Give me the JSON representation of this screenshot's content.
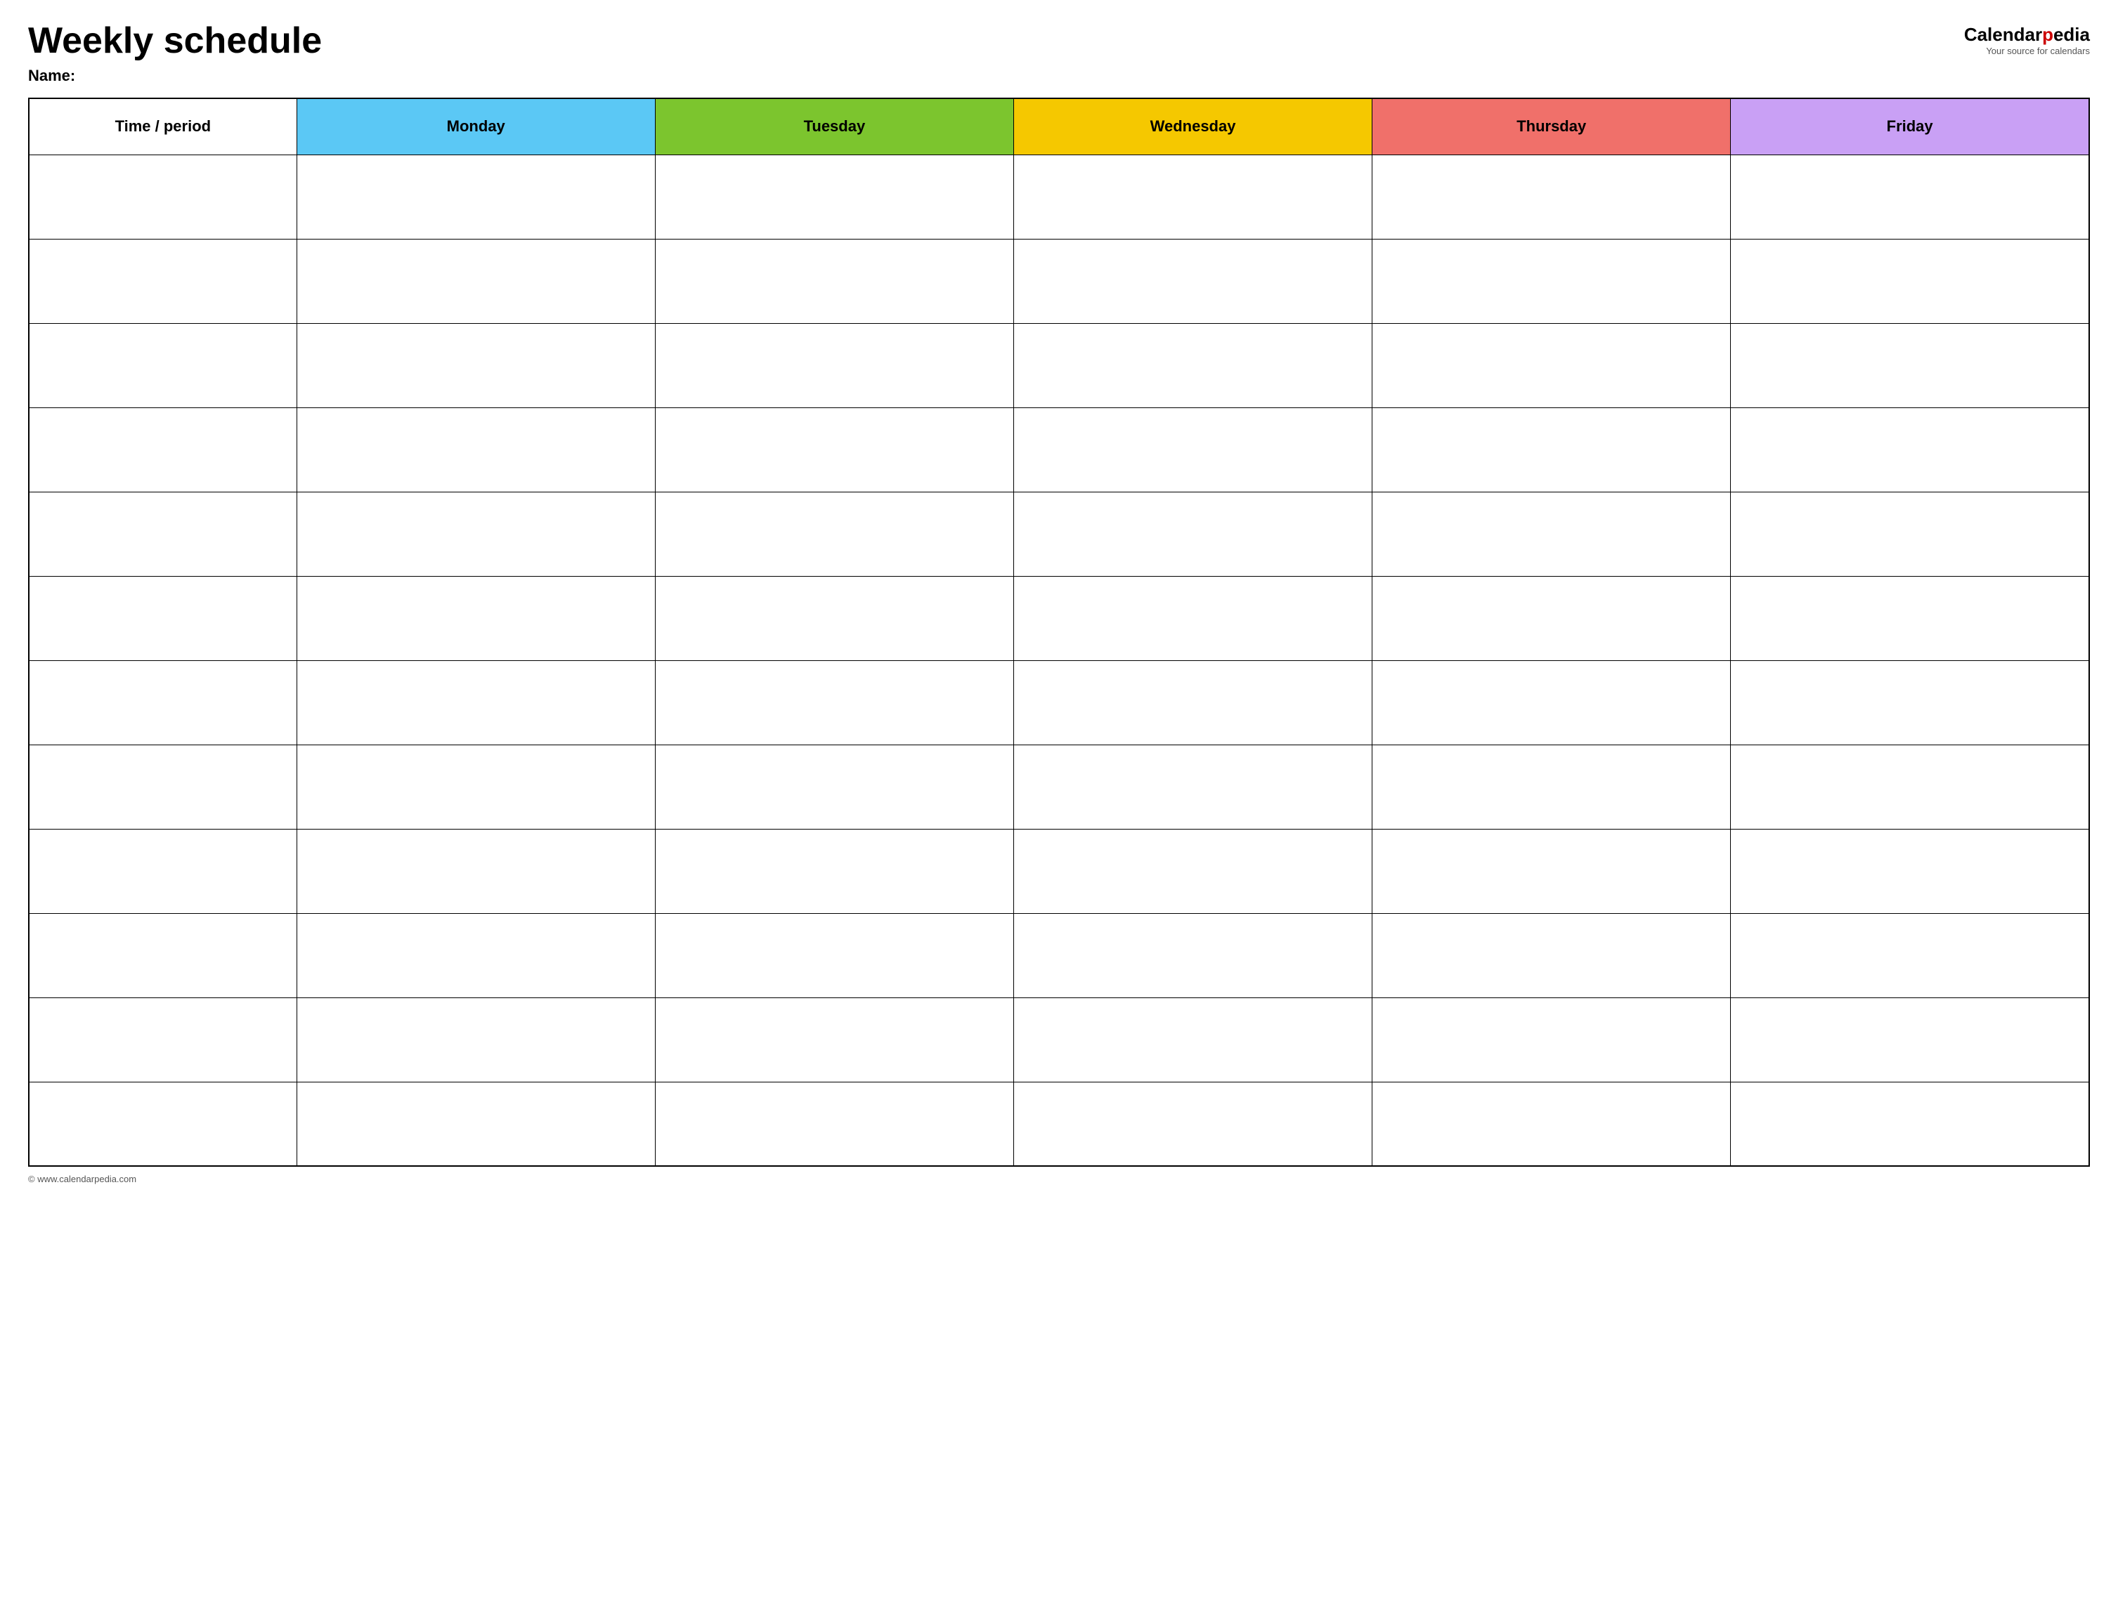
{
  "header": {
    "title": "Weekly schedule",
    "name_label": "Name:",
    "logo_calendar": "Calendar",
    "logo_pedia": "pedia",
    "logo_tagline": "Your source for calendars",
    "logo_url": "www.calendarpedia.com"
  },
  "table": {
    "columns": [
      {
        "id": "time",
        "label": "Time / period",
        "color": "#ffffff"
      },
      {
        "id": "monday",
        "label": "Monday",
        "color": "#5bc8f5"
      },
      {
        "id": "tuesday",
        "label": "Tuesday",
        "color": "#7cc52e"
      },
      {
        "id": "wednesday",
        "label": "Wednesday",
        "color": "#f5c800"
      },
      {
        "id": "thursday",
        "label": "Thursday",
        "color": "#f0706a"
      },
      {
        "id": "friday",
        "label": "Friday",
        "color": "#c9a0f5"
      }
    ],
    "row_count": 12
  },
  "footer": {
    "copyright": "© www.calendarpedia.com"
  }
}
